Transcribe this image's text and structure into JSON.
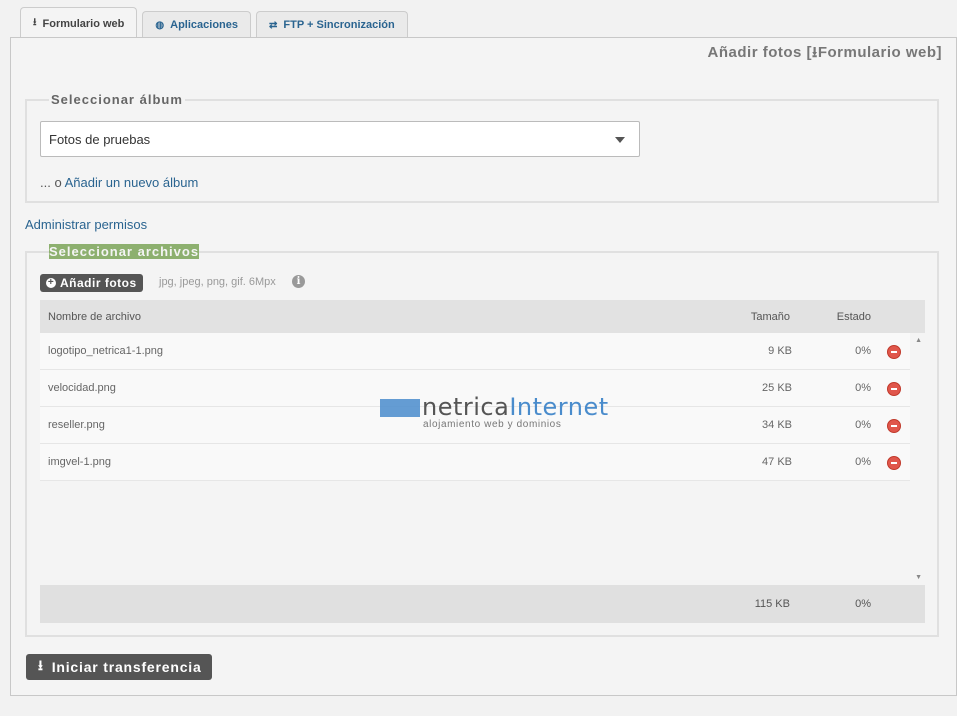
{
  "tabs": [
    {
      "label": "Formulario web",
      "icon": "upload-icon",
      "active": true
    },
    {
      "label": "Aplicaciones",
      "icon": "globe-icon",
      "active": false
    },
    {
      "label": "FTP + Sincronización",
      "icon": "sync-arrows-icon",
      "active": false
    }
  ],
  "page": {
    "heading_prefix": "Añadir fotos [",
    "heading_suffix": "Formulario web]"
  },
  "album": {
    "legend": "Seleccionar álbum",
    "selected": "Fotos de pruebas",
    "add_prefix": "... o",
    "add_link": "Añadir un nuevo álbum"
  },
  "permissions_link": "Administrar permisos",
  "files": {
    "legend": "Seleccionar archivos",
    "add_button": "Añadir fotos",
    "hint": "jpg, jpeg, png, gif. 6Mpx",
    "columns": {
      "name": "Nombre de archivo",
      "size": "Tamaño",
      "state": "Estado"
    },
    "rows": [
      {
        "name": "logotipo_netrica1-1.png",
        "size": "9 KB",
        "state": "0%"
      },
      {
        "name": "velocidad.png",
        "size": "25 KB",
        "state": "0%"
      },
      {
        "name": "reseller.png",
        "size": "34 KB",
        "state": "0%"
      },
      {
        "name": "imgvel-1.png",
        "size": "47 KB",
        "state": "0%"
      }
    ],
    "total_size": "115 KB",
    "total_state": "0%"
  },
  "watermark": {
    "brand_a": "netrica",
    "brand_b": "Internet",
    "tagline": "alojamiento web y dominios"
  },
  "start_button": "Iniciar transferencia",
  "colors": {
    "link": "#2a6490",
    "highlight": "#8db06f",
    "remove": "#e0564b",
    "dark_button": "#555555"
  }
}
